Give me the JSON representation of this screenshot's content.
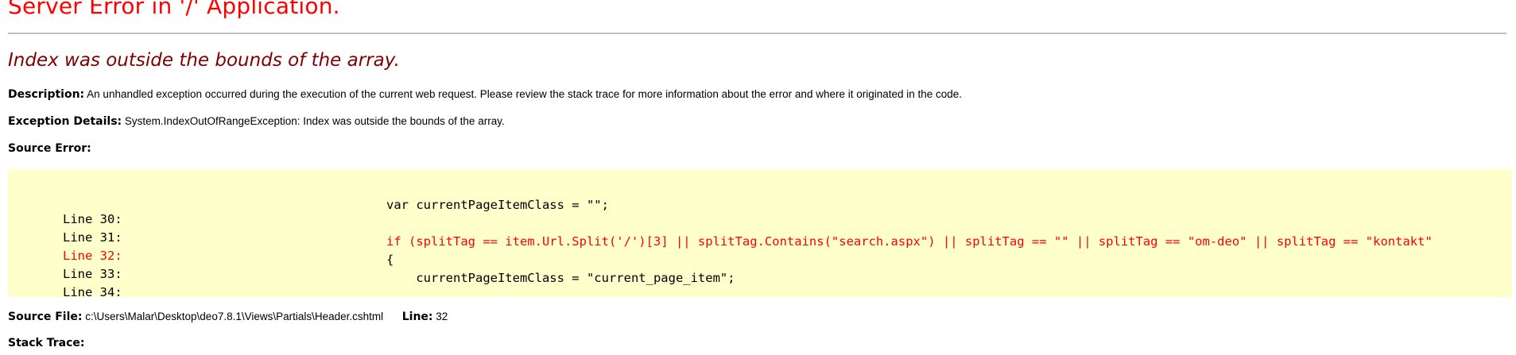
{
  "title": "Server Error in '/' Application.",
  "error_message": "Index was outside the bounds of the array.",
  "description": {
    "label": "Description:",
    "text": "An unhandled exception occurred during the execution of the current web request. Please review the stack trace for more information about the error and where it originated in the code."
  },
  "exception_details": {
    "label": "Exception Details:",
    "text": "System.IndexOutOfRangeException: Index was outside the bounds of the array."
  },
  "source_error": {
    "label": "Source Error:",
    "lines": [
      {
        "number": "Line 30:",
        "code": "var currentPageItemClass = \"\";",
        "highlighted": false
      },
      {
        "number": "Line 31:",
        "code": "",
        "highlighted": false
      },
      {
        "number": "Line 32:",
        "code": "if (splitTag == item.Url.Split('/')[3] || splitTag.Contains(\"search.aspx\") || splitTag == \"\" || splitTag == \"om-deo\" || splitTag == \"kontakt\"",
        "highlighted": true
      },
      {
        "number": "Line 33:",
        "code": "{",
        "highlighted": false
      },
      {
        "number": "Line 34:",
        "code": "    currentPageItemClass = \"current_page_item\";",
        "highlighted": false
      }
    ]
  },
  "source_file": {
    "label": "Source File:",
    "path": "c:\\Users\\Malar\\Desktop\\deo7.8.1\\Views\\Partials\\Header.cshtml",
    "line_label": "Line:",
    "line_value": "32"
  },
  "stack_trace": {
    "label": "Stack Trace:"
  },
  "colors": {
    "title": "#ff0000",
    "error_message": "#800000",
    "code_background": "#ffffcc",
    "highlighted_line": "#ff0000",
    "rule": "#c0c0c0"
  }
}
